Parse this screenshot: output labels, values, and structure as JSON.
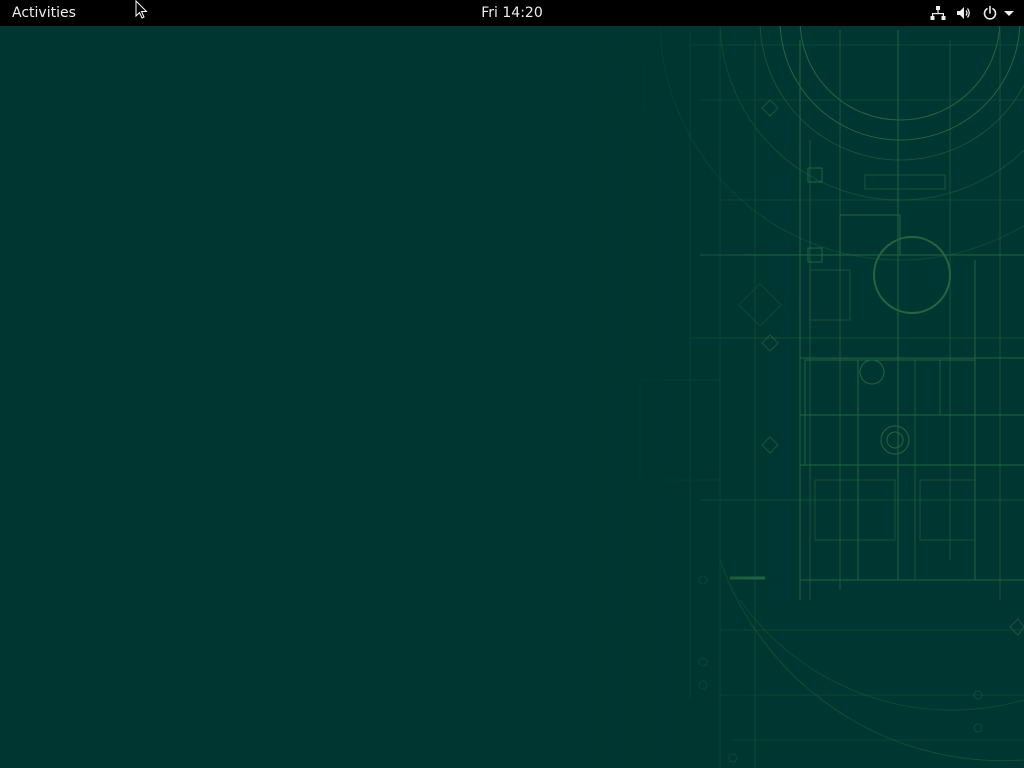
{
  "topbar": {
    "activities_label": "Activities",
    "clock": "Fri 14:20",
    "tray_icons": [
      "network-wired-icon",
      "volume-icon",
      "power-icon",
      "chevron-down-icon"
    ]
  },
  "colors": {
    "desktop_background": "#003631",
    "blueprint_lines": "#3f8f4c",
    "topbar": "#000000",
    "topbar_text": "#eeeeec"
  },
  "wallpaper": {
    "style": "architectural-blueprint"
  }
}
